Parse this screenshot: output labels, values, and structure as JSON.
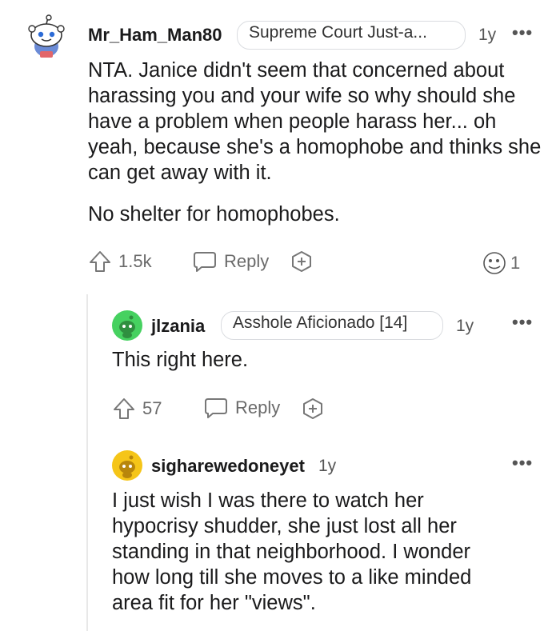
{
  "comments": [
    {
      "username": "Mr_Ham_Man80",
      "flair": "Supreme Court Just-a...",
      "age": "1y",
      "more": "•••",
      "paragraphs": [
        "NTA. Janice didn't seem that concerned about harassing you and your wife so why should she have a problem when people harass her... oh yeah, because she's a homophobe and thinks she can get away with it.",
        "No shelter for homophobes."
      ],
      "upvotes": "1.5k",
      "reply_label": "Reply",
      "award_count": "1",
      "avatar_icon": "snoo-avatar-icon"
    },
    {
      "username": "jlzania",
      "flair": "Asshole Aficionado [14]",
      "age": "1y",
      "more": "•••",
      "paragraphs": [
        "This right here."
      ],
      "upvotes": "57",
      "reply_label": "Reply",
      "avatar_icon": "green-snoo-avatar-icon"
    },
    {
      "username": "sigharewedoneyet",
      "age": "1y",
      "more": "•••",
      "paragraphs": [
        "I just wish I was there to watch her hypocrisy shudder, she just lost all her standing in that neighborhood. I wonder how long till she moves to a like minded area fit for her \"views\"."
      ],
      "avatar_icon": "yellow-snoo-avatar-icon"
    }
  ],
  "colors": {
    "green_avatar": "#46d160",
    "yellow_avatar": "#f5c518",
    "meta_text": "#555555",
    "action_text": "#6a6a6a"
  }
}
